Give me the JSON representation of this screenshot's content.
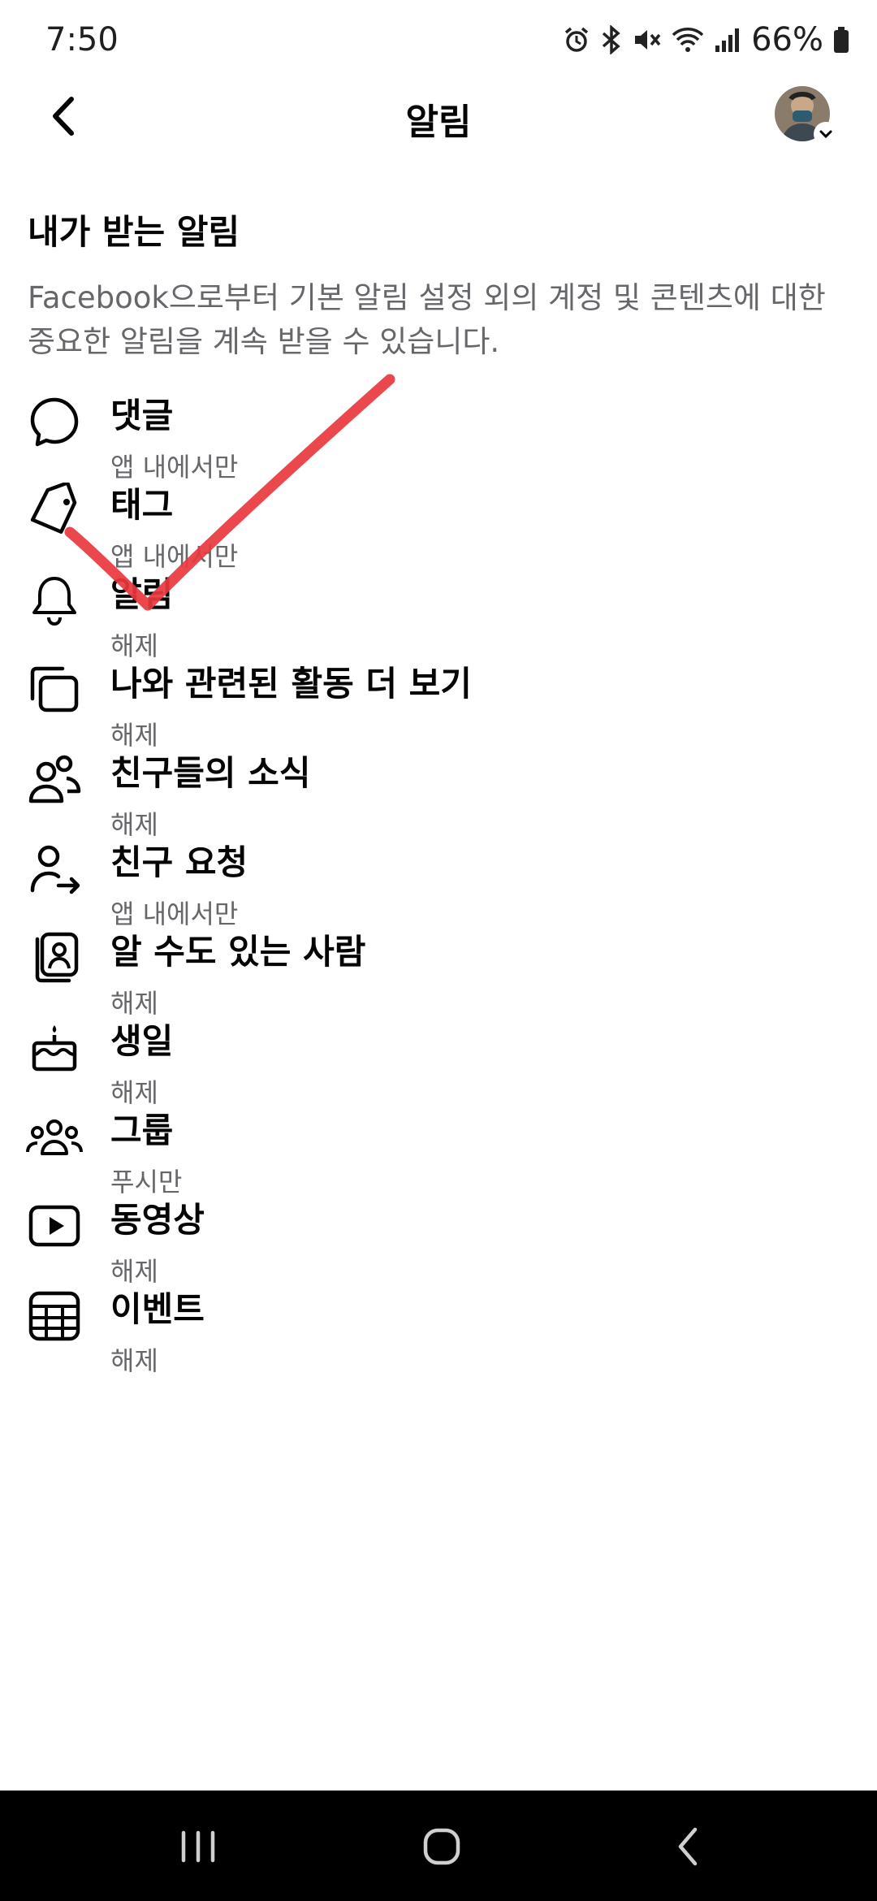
{
  "status_bar": {
    "time": "7:50",
    "battery": "66%",
    "icons": [
      "alarm-icon",
      "bluetooth-icon",
      "mute-icon",
      "wifi-icon",
      "signal-icon",
      "battery-icon"
    ]
  },
  "header": {
    "title": "알림"
  },
  "section": {
    "title": "내가 받는 알림",
    "description": "Facebook으로부터 기본 알림 설정 외의 계정 및 콘텐츠에 대한 중요한 알림을 계속 받을 수 있습니다."
  },
  "items": [
    {
      "label": "댓글",
      "status": "앱 내에서만",
      "icon": "comment-icon"
    },
    {
      "label": "태그",
      "status": "앱 내에서만",
      "icon": "tag-icon"
    },
    {
      "label": "알림",
      "status": "해제",
      "icon": "bell-icon"
    },
    {
      "label": "나와 관련된 활동 더 보기",
      "status": "해제",
      "icon": "activity-icon"
    },
    {
      "label": "친구들의 소식",
      "status": "해제",
      "icon": "friends-icon"
    },
    {
      "label": "친구 요청",
      "status": "앱 내에서만",
      "icon": "friend-request-icon"
    },
    {
      "label": "알 수도 있는 사람",
      "status": "해제",
      "icon": "people-you-may-know-icon"
    },
    {
      "label": "생일",
      "status": "해제",
      "icon": "birthday-cake-icon"
    },
    {
      "label": "그룹",
      "status": "푸시만",
      "icon": "groups-icon"
    },
    {
      "label": "동영상",
      "status": "해제",
      "icon": "video-icon"
    },
    {
      "label": "이벤트",
      "status": "해제",
      "icon": "calendar-icon"
    }
  ],
  "colors": {
    "text_primary": "#050505",
    "text_secondary": "#65676b",
    "annotation_red": "#e8383d",
    "nav_bar": "#000000"
  }
}
